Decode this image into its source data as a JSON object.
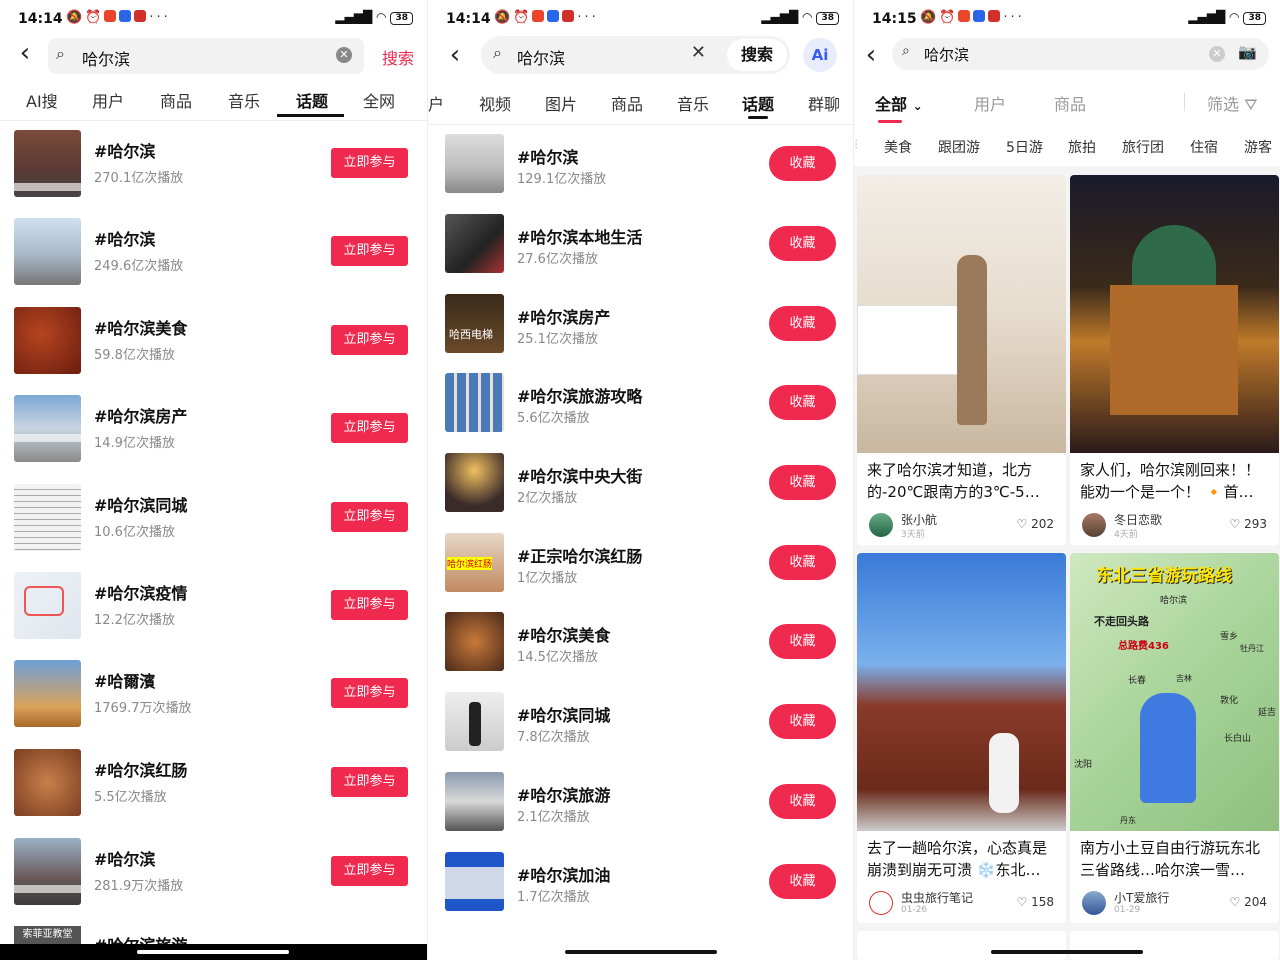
{
  "colors": {
    "accent": "#f0294e",
    "active_underline": "#111111"
  },
  "panel1": {
    "status": {
      "time": "14:14",
      "battery": "38",
      "signal": "⁵ᴳ▮▮▮ ᯤ"
    },
    "query": "哈尔滨",
    "search_button": "搜索",
    "tabs": [
      "AI搜",
      "用户",
      "商品",
      "音乐",
      "话题",
      "全网"
    ],
    "active_tab": "话题",
    "join_label": "立即参与",
    "items": [
      {
        "title": "#哈尔滨",
        "plays": "270.1亿次播放"
      },
      {
        "title": "#哈尔滨",
        "plays": "249.6亿次播放"
      },
      {
        "title": "#哈尔滨美食",
        "plays": "59.8亿次播放"
      },
      {
        "title": "#哈尔滨房产",
        "plays": "14.9亿次播放"
      },
      {
        "title": "#哈尔滨同城",
        "plays": "10.6亿次播放"
      },
      {
        "title": "#哈尔滨疫情",
        "plays": "12.2亿次播放"
      },
      {
        "title": "#哈爾濱",
        "plays": "1769.7万次播放"
      },
      {
        "title": "#哈尔滨红肠",
        "plays": "5.5亿次播放"
      },
      {
        "title": "#哈尔滨",
        "plays": "281.9万次播放"
      },
      {
        "title": "#哈尔滨旅游",
        "plays": ""
      }
    ],
    "thumb_texts": [
      "索菲亚教堂"
    ]
  },
  "panel2": {
    "status": {
      "time": "14:14",
      "battery": "38"
    },
    "query": "哈尔滨",
    "search_button": "搜索",
    "ai_button": "Ai",
    "tabs": [
      "户",
      "视频",
      "图片",
      "商品",
      "音乐",
      "话题",
      "群聊"
    ],
    "active_tab": "话题",
    "collect_label": "收藏",
    "items": [
      {
        "title": "#哈尔滨",
        "plays": "129.1亿次播放"
      },
      {
        "title": "#哈尔滨本地生活",
        "plays": "27.6亿次播放"
      },
      {
        "title": "#哈尔滨房产",
        "plays": "25.1亿次播放"
      },
      {
        "title": "#哈尔滨旅游攻略",
        "plays": "5.6亿次播放"
      },
      {
        "title": "#哈尔滨中央大街",
        "plays": "2亿次播放"
      },
      {
        "title": "#正宗哈尔滨红肠",
        "plays": "1亿次播放"
      },
      {
        "title": "#哈尔滨美食",
        "plays": "14.5亿次播放"
      },
      {
        "title": "#哈尔滨同城",
        "plays": "7.8亿次播放"
      },
      {
        "title": "#哈尔滨旅游",
        "plays": "2.1亿次播放"
      },
      {
        "title": "#哈尔滨加油",
        "plays": "1.7亿次播放"
      }
    ],
    "thumb_texts": [
      "哈西电梯",
      "哈尔滨红肠"
    ]
  },
  "panel3": {
    "status": {
      "time": "14:15",
      "battery": "38"
    },
    "query": "哈尔滨",
    "tabs": [
      "全部",
      "用户",
      "商品"
    ],
    "active_tab": "全部",
    "filter_label": "筛选",
    "chips": [
      "美食",
      "跟团游",
      "5日游",
      "旅拍",
      "旅行团",
      "住宿",
      "游客"
    ],
    "cards": [
      {
        "title": "来了哈尔滨才知道，北方的-20℃跟南方的3℃-5…",
        "author": "张小航",
        "time": "3天前",
        "likes": "202"
      },
      {
        "title": "家人们，哈尔滨刚回来！！能劝一个是一个！ 🔸首…",
        "author": "冬日恋歌",
        "time": "4天前",
        "likes": "293"
      },
      {
        "title": "去了一趟哈尔滨，心态真是崩溃到崩无可溃 ❄️东北…",
        "author": "虫虫旅行笔记",
        "time": "01-26",
        "likes": "158"
      },
      {
        "title": "南方小土豆自由行游玩东北三省路线…哈尔滨一雪…",
        "author": "小T爱旅行",
        "time": "01-29",
        "likes": "204"
      }
    ],
    "map_texts": {
      "headline": "东北三省游玩路线",
      "no_return": "不走回头路",
      "total": "总路费436",
      "cities": [
        "哈尔滨",
        "雪乡",
        "牡丹江",
        "长春",
        "吉林",
        "敦化",
        "延吉",
        "长白山",
        "沈阳",
        "丹东"
      ]
    }
  }
}
